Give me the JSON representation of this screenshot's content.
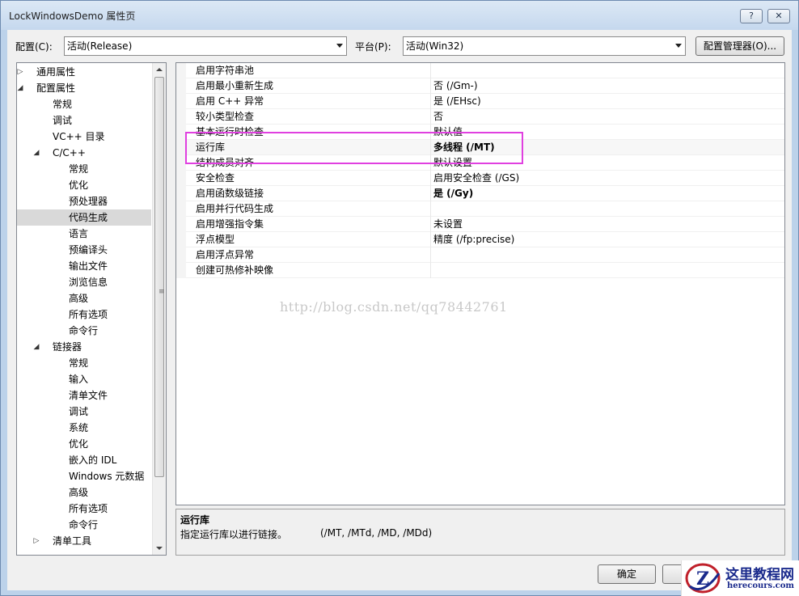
{
  "window": {
    "title": "LockWindowsDemo 属性页",
    "help_button": "?",
    "close_button": "✕"
  },
  "toolbar": {
    "config_label": "配置(C):",
    "config_value": "活动(Release)",
    "platform_label": "平台(P):",
    "platform_value": "活动(Win32)",
    "config_manager_button": "配置管理器(O)..."
  },
  "tree": {
    "items": [
      {
        "label": "通用属性",
        "level": 0,
        "toggle": "▷"
      },
      {
        "label": "配置属性",
        "level": 0,
        "toggle": "◢"
      },
      {
        "label": "常规",
        "level": 1,
        "toggle": ""
      },
      {
        "label": "调试",
        "level": 1,
        "toggle": ""
      },
      {
        "label": "VC++ 目录",
        "level": 1,
        "toggle": ""
      },
      {
        "label": "C/C++",
        "level": 1,
        "toggle": "◢"
      },
      {
        "label": "常规",
        "level": 2,
        "toggle": ""
      },
      {
        "label": "优化",
        "level": 2,
        "toggle": ""
      },
      {
        "label": "预处理器",
        "level": 2,
        "toggle": ""
      },
      {
        "label": "代码生成",
        "level": 2,
        "toggle": "",
        "selected": true
      },
      {
        "label": "语言",
        "level": 2,
        "toggle": ""
      },
      {
        "label": "预编译头",
        "level": 2,
        "toggle": ""
      },
      {
        "label": "输出文件",
        "level": 2,
        "toggle": ""
      },
      {
        "label": "浏览信息",
        "level": 2,
        "toggle": ""
      },
      {
        "label": "高级",
        "level": 2,
        "toggle": ""
      },
      {
        "label": "所有选项",
        "level": 2,
        "toggle": ""
      },
      {
        "label": "命令行",
        "level": 2,
        "toggle": ""
      },
      {
        "label": "链接器",
        "level": 1,
        "toggle": "◢"
      },
      {
        "label": "常规",
        "level": 2,
        "toggle": ""
      },
      {
        "label": "输入",
        "level": 2,
        "toggle": ""
      },
      {
        "label": "清单文件",
        "level": 2,
        "toggle": ""
      },
      {
        "label": "调试",
        "level": 2,
        "toggle": ""
      },
      {
        "label": "系统",
        "level": 2,
        "toggle": ""
      },
      {
        "label": "优化",
        "level": 2,
        "toggle": ""
      },
      {
        "label": "嵌入的 IDL",
        "level": 2,
        "toggle": ""
      },
      {
        "label": "Windows 元数据",
        "level": 2,
        "toggle": ""
      },
      {
        "label": "高级",
        "level": 2,
        "toggle": ""
      },
      {
        "label": "所有选项",
        "level": 2,
        "toggle": ""
      },
      {
        "label": "命令行",
        "level": 2,
        "toggle": ""
      },
      {
        "label": "清单工具",
        "level": 1,
        "toggle": "▷"
      }
    ]
  },
  "grid": {
    "rows": [
      {
        "name": "启用字符串池",
        "value": ""
      },
      {
        "name": "启用最小重新生成",
        "value": "否 (/Gm-)"
      },
      {
        "name": "启用 C++ 异常",
        "value": "是 (/EHsc)"
      },
      {
        "name": "较小类型检查",
        "value": "否"
      },
      {
        "name": "基本运行时检查",
        "value": "默认值"
      },
      {
        "name": "运行库",
        "value": "多线程 (/MT)",
        "bold": true
      },
      {
        "name": "结构成员对齐",
        "value": "默认设置"
      },
      {
        "name": "安全检查",
        "value": "启用安全检查 (/GS)"
      },
      {
        "name": "启用函数级链接",
        "value": "是 (/Gy)",
        "bold": true
      },
      {
        "name": "启用并行代码生成",
        "value": ""
      },
      {
        "name": "启用增强指令集",
        "value": "未设置"
      },
      {
        "name": "浮点模型",
        "value": "精度 (/fp:precise)"
      },
      {
        "name": "启用浮点异常",
        "value": ""
      },
      {
        "name": "创建可热修补映像",
        "value": ""
      }
    ]
  },
  "watermark": "http://blog.csdn.net/qq78442761",
  "description": {
    "title": "运行库",
    "text": "指定运行库以进行链接。",
    "options": "(/MT, /MTd, /MD, /MDd)"
  },
  "footer": {
    "ok_button": "确定",
    "cancel_button": ""
  },
  "logo": {
    "name": "这里教程网",
    "url": "herecours.com",
    "letter": "Z"
  },
  "colors": {
    "highlight": "#e040e0",
    "logo": "#1a2a8c"
  }
}
